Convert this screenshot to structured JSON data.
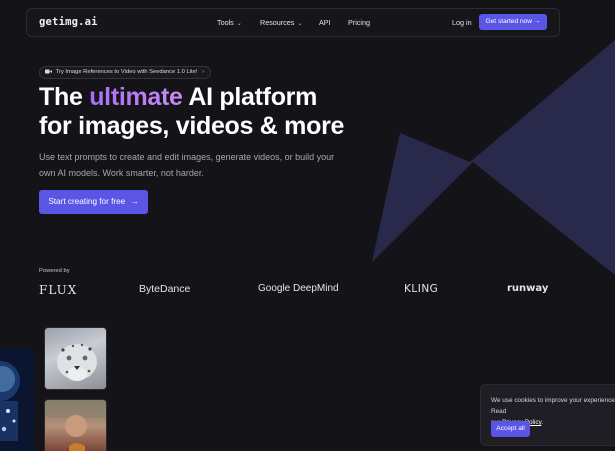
{
  "logo": "getimg.ai",
  "nav": {
    "items": [
      {
        "label": "Tools",
        "has_dropdown": true
      },
      {
        "label": "Resources",
        "has_dropdown": true
      },
      {
        "label": "API",
        "has_dropdown": false
      },
      {
        "label": "Pricing",
        "has_dropdown": false
      }
    ],
    "login": "Log in",
    "get_started": "Get started now",
    "get_started_arrow": "→",
    "chevron": "⌄"
  },
  "announcement": {
    "icon": "video-camera-icon",
    "text": "Try Image References to Video with Seedance 1.0 Lite!",
    "arrow": "›"
  },
  "hero": {
    "headline_pre": "The ",
    "headline_accent": "ultimate",
    "headline_line1_post": " AI platform",
    "headline_line2": "for images, videos & more",
    "subtext": "Use text prompts to create and edit images, generate videos, or build your own AI models. Work smarter, not harder.",
    "cta": "Start creating for free",
    "cta_arrow": "→"
  },
  "powered_by": {
    "label": "Powered by",
    "brands": [
      "FLUX",
      "ByteDance",
      "Google DeepMind",
      "KLING",
      "runway"
    ]
  },
  "cookie": {
    "text_pre": "We use cookies to improve your experience. Read",
    "text_mid": "our ",
    "link": "Privacy Policy",
    "text_post": ".",
    "accept": "Accept all"
  },
  "colors": {
    "background": "#141318",
    "accent": "#5b55e6",
    "gradient_text": "#a56ff6",
    "decor_shape": "#2a2b4e"
  }
}
